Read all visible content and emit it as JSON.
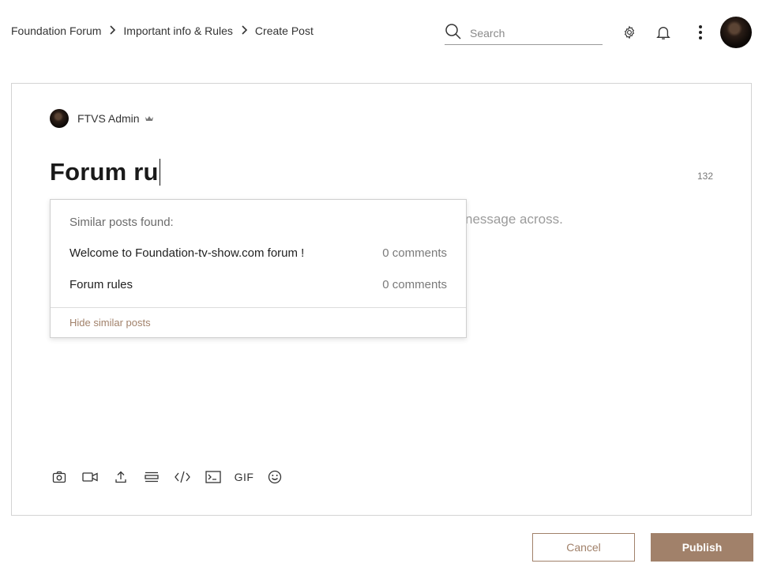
{
  "breadcrumb": {
    "items": [
      "Foundation Forum",
      "Important info & Rules",
      "Create Post"
    ],
    "separator": ">"
  },
  "search": {
    "placeholder": "Search",
    "value": ""
  },
  "header_icons": [
    "gear-icon",
    "bell-icon",
    "more-vertical-icon"
  ],
  "author": {
    "name": "FTVS Admin",
    "badge": "crown-icon"
  },
  "editor": {
    "title_value": "Forum ru",
    "char_counter": "132",
    "body_placeholder_visible": "nessage across."
  },
  "similar_posts": {
    "heading": "Similar posts found:",
    "posts": [
      {
        "title": "Welcome to Foundation-tv-show.com forum !",
        "comments": "0 comments"
      },
      {
        "title": "Forum rules",
        "comments": "0 comments"
      }
    ],
    "hide_label": "Hide similar posts"
  },
  "toolbar": {
    "tools": [
      "camera-icon",
      "video-icon",
      "upload-icon",
      "divider-icon",
      "code-icon",
      "code-block-icon",
      "gif-icon",
      "emoji-icon"
    ],
    "gif_label": "GIF"
  },
  "actions": {
    "cancel_label": "Cancel",
    "publish_label": "Publish"
  },
  "colors": {
    "accent": "#a1816a",
    "border": "#d3d3d3",
    "text": "#222222"
  }
}
